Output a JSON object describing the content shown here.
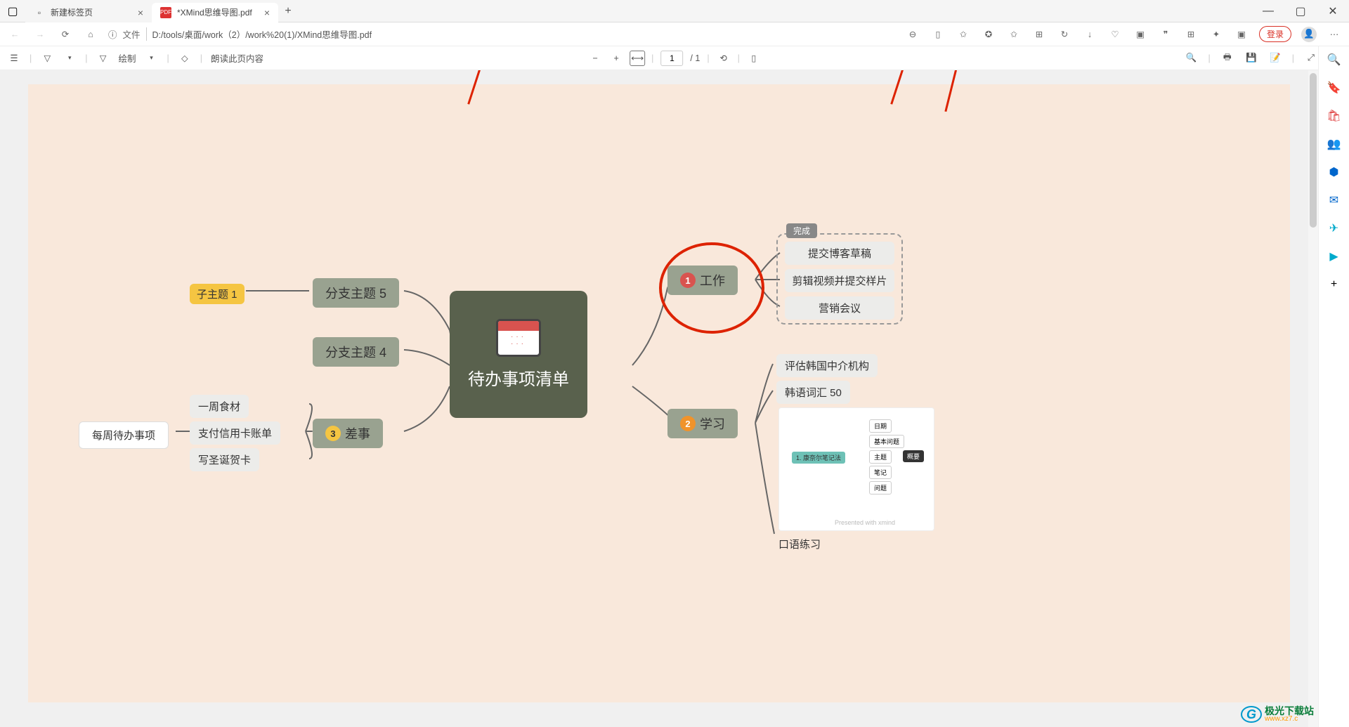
{
  "tabs": {
    "tab1": {
      "title": "新建标签页"
    },
    "tab2": {
      "title": "*XMind思维导图.pdf"
    }
  },
  "url_bar": {
    "file_label": "文件",
    "path": "D:/tools/桌面/work（2）/work%20(1)/XMind思维导图.pdf",
    "login": "登录"
  },
  "pdf_toolbar": {
    "draw": "绘制",
    "read_aloud": "朗读此页内容",
    "page_current": "1",
    "page_total": "/ 1"
  },
  "mindmap": {
    "center": "待办事项清单",
    "branch5": "分支主题 5",
    "branch4": "分支主题 4",
    "sub1": "子主题 1",
    "chores": "差事",
    "chores_badge": "3",
    "chores_items": {
      "a": "一周食材",
      "b": "支付信用卡账单",
      "c": "写圣诞贺卡"
    },
    "weekly": "每周待办事项",
    "work": "工作",
    "work_badge": "1",
    "work_group_label": "完成",
    "work_items": {
      "a": "提交博客草稿",
      "b": "剪辑视频并提交样片",
      "c": "营销会议"
    },
    "study": "学习",
    "study_badge": "2",
    "study_items": {
      "a": "评估韩国中介机构",
      "b": "韩语词汇 50",
      "c": "口语练习"
    },
    "mini": {
      "center": "1. 康奈尔笔记法",
      "a": "日期",
      "b": "基本问题",
      "c": "主题",
      "d": "笔记",
      "e": "问题",
      "summary": "概要"
    },
    "mini_footer": "Presented with xmind"
  },
  "watermark": {
    "title": "极光下载站",
    "url": "www.xz7.c"
  }
}
